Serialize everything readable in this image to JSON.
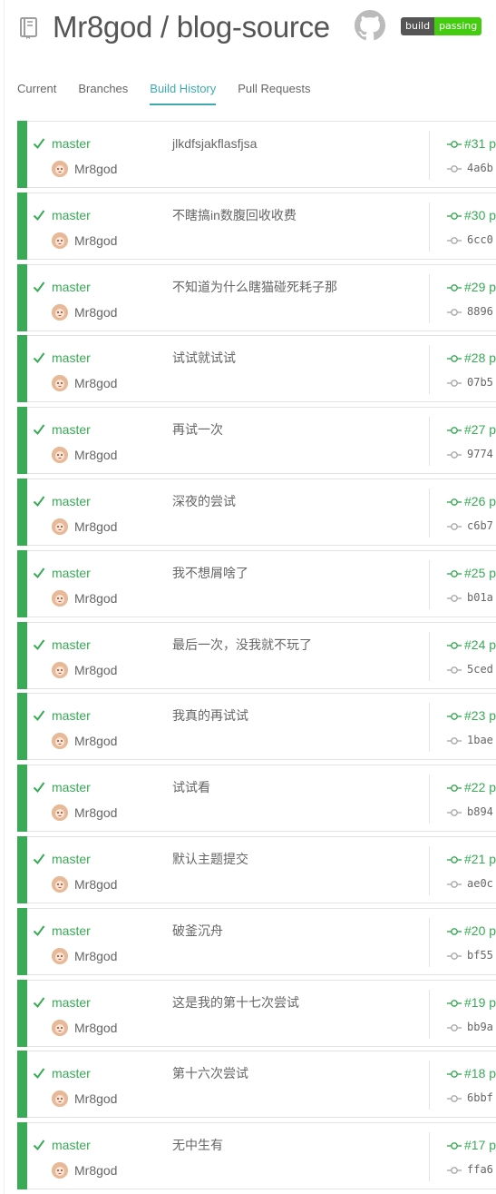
{
  "header": {
    "repo_title": "Mr8god / blog-source",
    "badge_left": "build",
    "badge_right": "passing"
  },
  "tabs": [
    {
      "label": "Current"
    },
    {
      "label": "Branches"
    },
    {
      "label": "Build History"
    },
    {
      "label": "Pull Requests"
    }
  ],
  "active_tab": "Build History",
  "colors": {
    "passed": "#39aa56",
    "accent": "#3eaaaf",
    "badge_passing": "#4c1"
  },
  "builds": [
    {
      "branch": "master",
      "author": "Mr8god",
      "message": "jlkdfsjakflasfjsa",
      "number": "#31 p",
      "sha": "4a6b"
    },
    {
      "branch": "master",
      "author": "Mr8god",
      "message": "不瞎搞in数腹回收收费",
      "number": "#30 p",
      "sha": "6cc0"
    },
    {
      "branch": "master",
      "author": "Mr8god",
      "message": "不知道为什么瞎猫碰死耗子那",
      "number": "#29 p",
      "sha": "8896"
    },
    {
      "branch": "master",
      "author": "Mr8god",
      "message": "试试就试试",
      "number": "#28 p",
      "sha": "07b5"
    },
    {
      "branch": "master",
      "author": "Mr8god",
      "message": "再试一次",
      "number": "#27 p",
      "sha": "9774"
    },
    {
      "branch": "master",
      "author": "Mr8god",
      "message": "深夜的尝试",
      "number": "#26 p",
      "sha": "c6b7"
    },
    {
      "branch": "master",
      "author": "Mr8god",
      "message": "我不想屑啥了",
      "number": "#25 p",
      "sha": "b01a"
    },
    {
      "branch": "master",
      "author": "Mr8god",
      "message": "最后一次，没我就不玩了",
      "number": "#24 p",
      "sha": "5ced"
    },
    {
      "branch": "master",
      "author": "Mr8god",
      "message": "我真的再试试",
      "number": "#23 p",
      "sha": "1bae"
    },
    {
      "branch": "master",
      "author": "Mr8god",
      "message": "试试看",
      "number": "#22 p",
      "sha": "b894"
    },
    {
      "branch": "master",
      "author": "Mr8god",
      "message": "默认主题提交",
      "number": "#21 p",
      "sha": "ae0c"
    },
    {
      "branch": "master",
      "author": "Mr8god",
      "message": "破釜沉舟",
      "number": "#20 p",
      "sha": "bf55"
    },
    {
      "branch": "master",
      "author": "Mr8god",
      "message": "这是我的第十七次尝试",
      "number": "#19 p",
      "sha": "bb9a"
    },
    {
      "branch": "master",
      "author": "Mr8god",
      "message": "第十六次尝试",
      "number": "#18 p",
      "sha": "6bbf"
    },
    {
      "branch": "master",
      "author": "Mr8god",
      "message": "无中生有",
      "number": "#17 p",
      "sha": "ffa6"
    }
  ]
}
